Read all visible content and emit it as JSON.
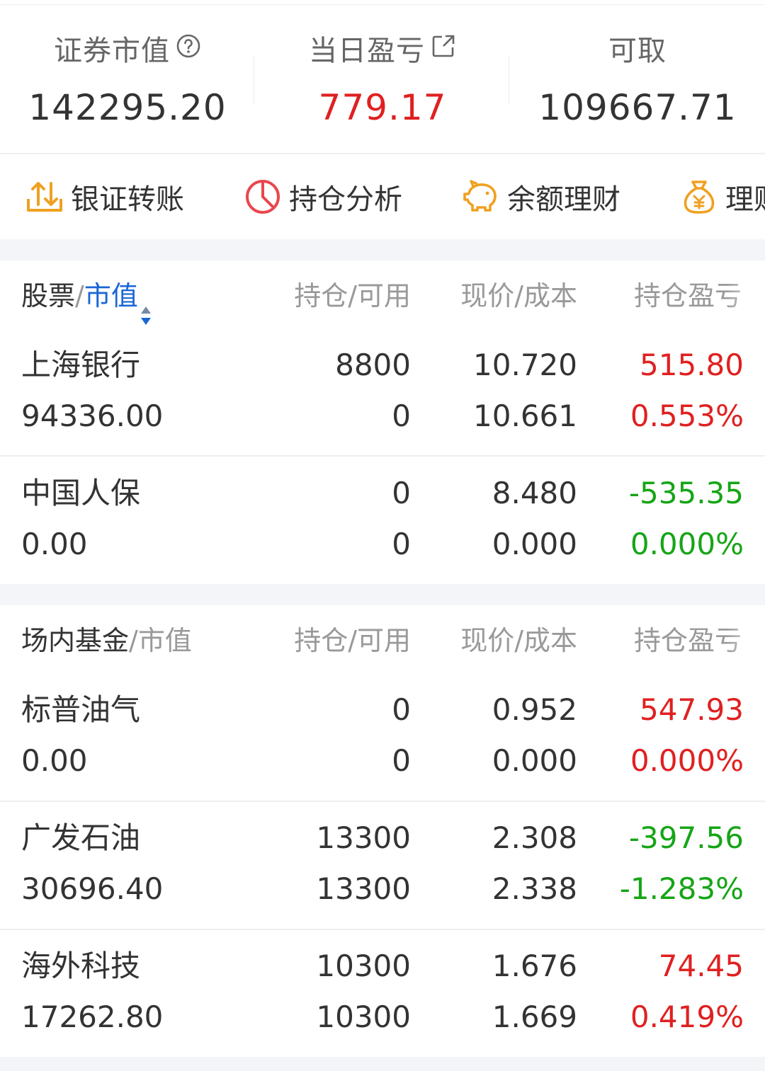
{
  "summary": {
    "market_value": {
      "label": "证券市值",
      "value": "142295.20",
      "icon": "help-circle-icon"
    },
    "daily_pl": {
      "label": "当日盈亏",
      "value": "779.17",
      "icon": "external-link-icon",
      "color": "#e02020"
    },
    "withdrawable": {
      "label": "可取",
      "value": "109667.71"
    }
  },
  "actions": [
    {
      "label": "银证转账",
      "icon": "transfer-icon"
    },
    {
      "label": "持仓分析",
      "icon": "pie-chart-icon"
    },
    {
      "label": "余额理财",
      "icon": "piggy-bank-icon"
    },
    {
      "label": "理财",
      "icon": "money-bag-icon"
    }
  ],
  "stocks": {
    "header": {
      "type_label": "股票",
      "sort_label": "市值",
      "position_label": "持仓/可用",
      "price_label": "现价/成本",
      "pl_label": "持仓盈亏"
    },
    "rows": [
      {
        "name": "上海银行",
        "market_value": "94336.00",
        "position": "8800",
        "available": "0",
        "price": "10.720",
        "cost": "10.661",
        "pl": "515.80",
        "pl_pct": "0.553%",
        "trend": "up"
      },
      {
        "name": "中国人保",
        "market_value": "0.00",
        "position": "0",
        "available": "0",
        "price": "8.480",
        "cost": "0.000",
        "pl": "-535.35",
        "pl_pct": "0.000%",
        "trend": "down"
      }
    ]
  },
  "funds": {
    "header": {
      "type_label": "场内基金",
      "sort_label": "市值",
      "position_label": "持仓/可用",
      "price_label": "现价/成本",
      "pl_label": "持仓盈亏"
    },
    "rows": [
      {
        "name": "标普油气",
        "market_value": "0.00",
        "position": "0",
        "available": "0",
        "price": "0.952",
        "cost": "0.000",
        "pl": "547.93",
        "pl_pct": "0.000%",
        "trend": "up"
      },
      {
        "name": "广发石油",
        "market_value": "30696.40",
        "position": "13300",
        "available": "13300",
        "price": "2.308",
        "cost": "2.338",
        "pl": "-397.56",
        "pl_pct": "-1.283%",
        "trend": "down"
      },
      {
        "name": "海外科技",
        "market_value": "17262.80",
        "position": "10300",
        "available": "10300",
        "price": "1.676",
        "cost": "1.669",
        "pl": "74.45",
        "pl_pct": "0.419%",
        "trend": "up"
      }
    ]
  },
  "colors": {
    "up": "#e02020",
    "down": "#16a516",
    "accent": "#1a66d6",
    "icon_orange": "#f0a020",
    "icon_red": "#e8474f"
  }
}
